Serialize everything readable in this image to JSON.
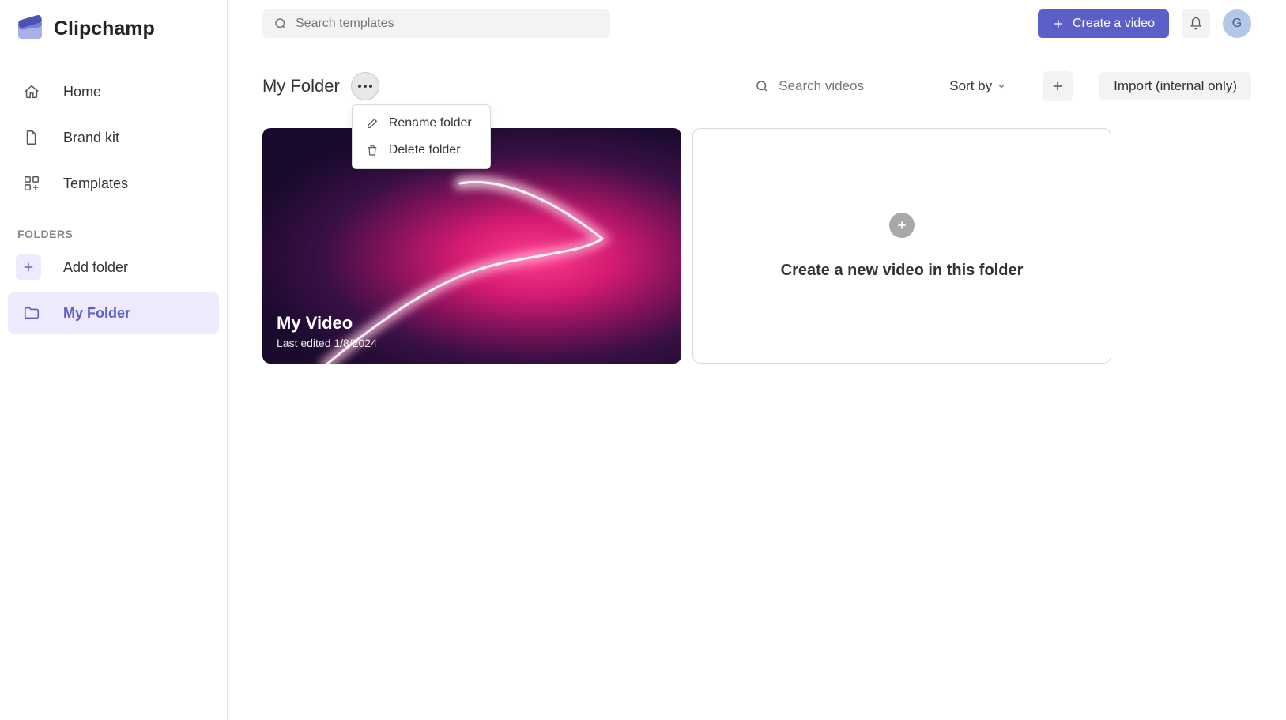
{
  "brand": {
    "name": "Clipchamp"
  },
  "sidebar": {
    "items": [
      {
        "label": "Home"
      },
      {
        "label": "Brand kit"
      },
      {
        "label": "Templates"
      }
    ],
    "folders_section_label": "FOLDERS",
    "add_folder_label": "Add folder",
    "folders": [
      {
        "label": "My Folder"
      }
    ]
  },
  "topbar": {
    "search_placeholder": "Search templates",
    "create_label": "Create a video",
    "avatar_initial": "G"
  },
  "folder_header": {
    "title": "My Folder",
    "search_placeholder": "Search videos",
    "sort_label": "Sort by",
    "import_label": "Import (internal only)"
  },
  "folder_menu": {
    "rename_label": "Rename folder",
    "delete_label": "Delete folder"
  },
  "videos": [
    {
      "title": "My Video",
      "last_edited": "Last edited 1/8/2024"
    }
  ],
  "create_card": {
    "label": "Create a new video in this folder"
  }
}
